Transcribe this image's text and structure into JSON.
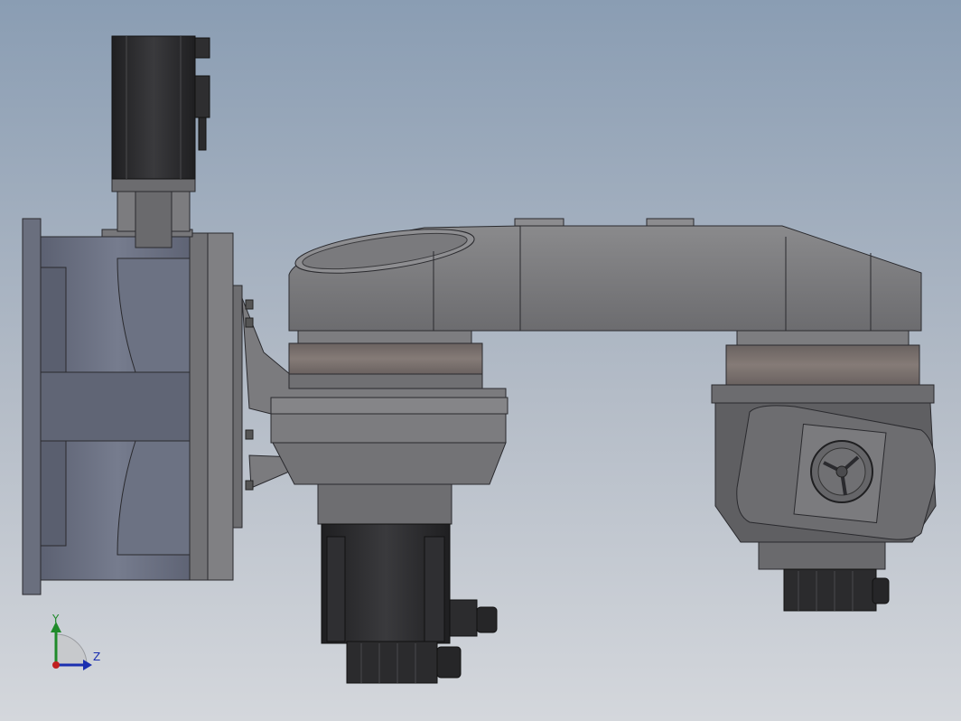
{
  "viewport": {
    "background_top": "#8a9db3",
    "background_bottom": "#d4d7dc"
  },
  "model": {
    "parts": [
      "base-flange",
      "servo-motor-top",
      "motor-gearbox-adapter",
      "mounting-bracket",
      "first-arm-link",
      "second-arm-link",
      "joint-bearing-ring",
      "servo-motor-bottom",
      "end-effector-housing",
      "tool-flange"
    ],
    "colors": {
      "body": "#7a7a7d",
      "body_dark": "#5a5a5e",
      "base": "#666b7c",
      "ring": "#7b7370",
      "motor": "#2c2c2e"
    }
  },
  "triad": {
    "y_label": "Y",
    "z_label": "Z",
    "y_color": "#1f8a2a",
    "z_color": "#1b2fb0",
    "x_color": "#c0201e"
  }
}
